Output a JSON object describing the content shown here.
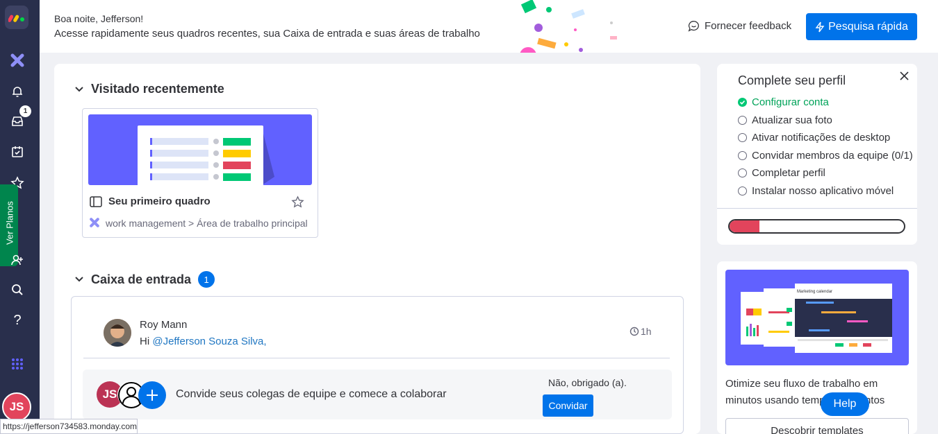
{
  "greeting": {
    "hello": "Boa noite, Jefferson!",
    "subtitle": "Acesse rapidamente seus quadros recentes, sua Caixa de entrada e suas áreas de trabalho"
  },
  "header": {
    "feedback_label": "Fornecer feedback",
    "quick_search_label": "Pesquisa rápida"
  },
  "sidebar": {
    "inbox_badge": "1",
    "plans_label": "Ver Planos",
    "avatar_initials": "JS"
  },
  "recent": {
    "title": "Visitado recentemente",
    "board_name": "Seu primeiro quadro",
    "board_path": "work management > Área de trabalho principal"
  },
  "inbox": {
    "title": "Caixa de entrada",
    "count": "1",
    "author": "Roy Mann",
    "message_prefix": "Hi ",
    "mention": "@Jefferson Souza Silva,",
    "time": "1h"
  },
  "invite": {
    "avatar_initials": "JS",
    "text": "Convide seus colegas de equipe e comece a colaborar",
    "decline": "Não, obrigado (a).",
    "button": "Convidar"
  },
  "profile": {
    "title": "Complete seu perfil",
    "steps": [
      {
        "label": "Configurar conta",
        "done": true
      },
      {
        "label": "Atualizar sua foto",
        "done": false
      },
      {
        "label": "Ativar notificações de desktop",
        "done": false
      },
      {
        "label": "Convidar membros da equipe (0/1)",
        "done": false
      },
      {
        "label": "Completar perfil",
        "done": false
      },
      {
        "label": "Instalar nosso aplicativo móvel",
        "done": false
      }
    ],
    "progress": 0.17
  },
  "templates": {
    "description": "Otimize seu fluxo de trabalho em minutos usando templates prontos",
    "thumb_title": "Marketing calendar",
    "button": "Descobrir templates"
  },
  "help_label": "Help",
  "status_url": "https://jefferson734583.monday.com",
  "colors": {
    "accent": "#0073ea",
    "sidebar": "#292f4c",
    "success": "#00c875",
    "danger": "#e2445c"
  }
}
